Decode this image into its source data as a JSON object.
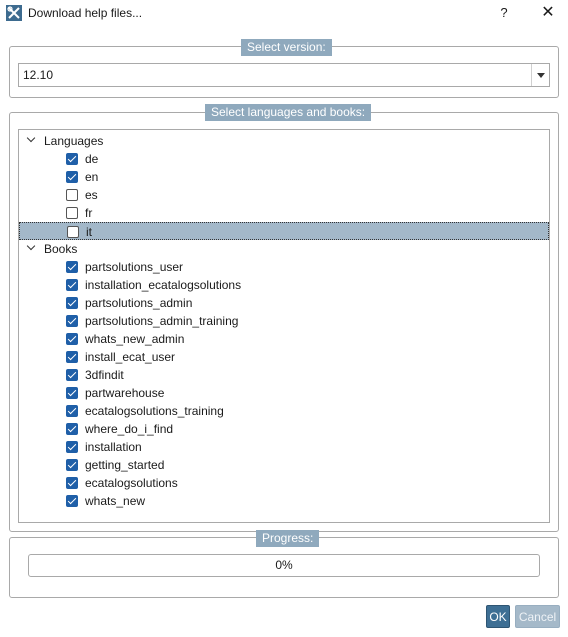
{
  "window": {
    "title": "Download help files...",
    "help_label": "?",
    "close_label": "✕"
  },
  "version_group": {
    "title": "Select version:",
    "selected_value": "12.10"
  },
  "books_group": {
    "title": "Select languages and books:",
    "nodes": [
      {
        "label": "Languages",
        "kind": "parent"
      },
      {
        "label": "de",
        "checked": true
      },
      {
        "label": "en",
        "checked": true
      },
      {
        "label": "es",
        "checked": false
      },
      {
        "label": "fr",
        "checked": false
      },
      {
        "label": "it",
        "checked": false,
        "selected": true
      },
      {
        "label": "Books",
        "kind": "parent"
      },
      {
        "label": "partsolutions_user",
        "checked": true
      },
      {
        "label": "installation_ecatalogsolutions",
        "checked": true
      },
      {
        "label": "partsolutions_admin",
        "checked": true
      },
      {
        "label": "partsolutions_admin_training",
        "checked": true
      },
      {
        "label": "whats_new_admin",
        "checked": true
      },
      {
        "label": "install_ecat_user",
        "checked": true
      },
      {
        "label": "3dfindit",
        "checked": true
      },
      {
        "label": "partwarehouse",
        "checked": true
      },
      {
        "label": "ecatalogsolutions_training",
        "checked": true
      },
      {
        "label": "where_do_i_find",
        "checked": true
      },
      {
        "label": "installation",
        "checked": true
      },
      {
        "label": "getting_started",
        "checked": true
      },
      {
        "label": "ecatalogsolutions",
        "checked": true
      },
      {
        "label": "whats_new",
        "checked": true
      }
    ]
  },
  "progress_group": {
    "title": "Progress:",
    "value_text": "0%",
    "value": 0
  },
  "buttons": {
    "ok_label": "OK",
    "cancel_label": "Cancel"
  },
  "colors": {
    "group_title_bg": "#8fa9bd",
    "checkbox_checked": "#1f5fa8",
    "selection": "#a3b8c9",
    "ok_bg": "#3e6f94"
  }
}
